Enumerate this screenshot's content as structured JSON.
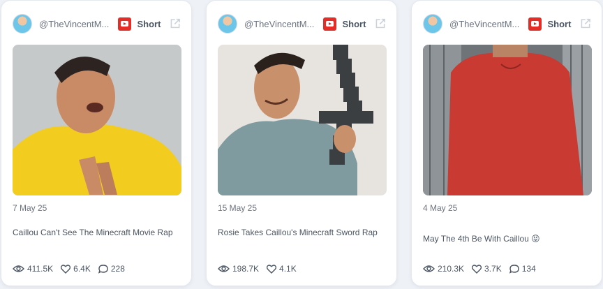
{
  "colors": {
    "background": "#eef1f6",
    "card": "#ffffff",
    "youtube_red": "#e52d27",
    "text": "#4b5563"
  },
  "cards": [
    {
      "handle": "@TheVincentM...",
      "platform_label": "Short",
      "platform_icon": "youtube-icon",
      "date": "7 May 25",
      "title": "Caillou Can't See The Minecraft Movie Rap",
      "views": "411.5K",
      "likes": "6.4K",
      "comments": "228"
    },
    {
      "handle": "@TheVincentM...",
      "platform_label": "Short",
      "platform_icon": "youtube-icon",
      "date": "15 May 25",
      "title": "Rosie Takes Caillou's Minecraft Sword Rap",
      "views": "198.7K",
      "likes": "4.1K"
    },
    {
      "handle": "@TheVincentM...",
      "platform_label": "Short",
      "platform_icon": "youtube-icon",
      "date": "4 May 25",
      "title": "May The 4th Be With Caillou 😝",
      "views": "210.3K",
      "likes": "3.7K",
      "comments": "134"
    }
  ]
}
